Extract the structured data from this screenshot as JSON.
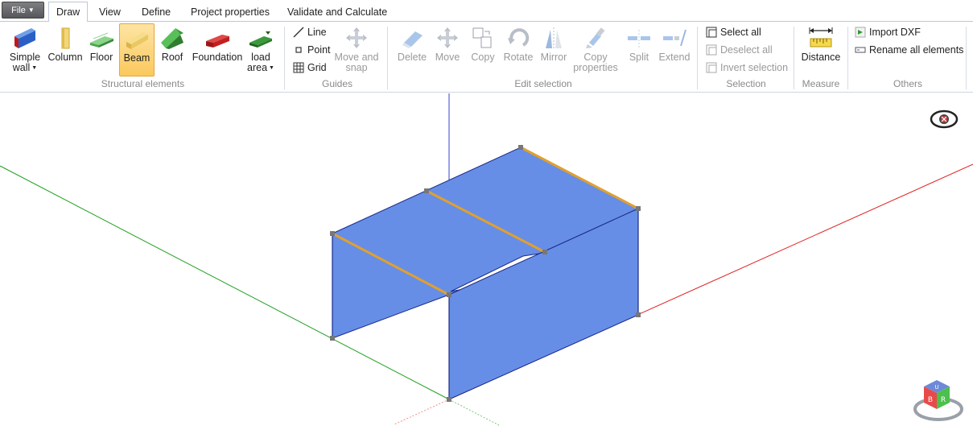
{
  "file_menu": {
    "label": "File"
  },
  "tabs": [
    {
      "label": "Draw",
      "active": true
    },
    {
      "label": "View"
    },
    {
      "label": "Define"
    },
    {
      "label": "Project properties"
    },
    {
      "label": "Validate and Calculate"
    }
  ],
  "groups": {
    "structural": {
      "label": "Structural elements",
      "buttons": [
        {
          "label1": "Simple",
          "label2": "wall"
        },
        {
          "label1": "Column"
        },
        {
          "label1": "Floor"
        },
        {
          "label1": "Beam",
          "selected": true
        },
        {
          "label1": "Roof"
        },
        {
          "label1": "Foundation"
        },
        {
          "label1": "load",
          "label2": "area"
        }
      ]
    },
    "guides": {
      "label": "Guides",
      "line": "Line",
      "point": "Point",
      "grid": "Grid",
      "move_snap_1": "Move and",
      "move_snap_2": "snap"
    },
    "edit": {
      "label": "Edit selection",
      "buttons": [
        {
          "label1": "Delete"
        },
        {
          "label1": "Move"
        },
        {
          "label1": "Copy"
        },
        {
          "label1": "Rotate"
        },
        {
          "label1": "Mirror"
        },
        {
          "label1": "Copy",
          "label2": "properties"
        },
        {
          "label1": "Split"
        },
        {
          "label1": "Extend"
        }
      ]
    },
    "selection": {
      "label": "Selection",
      "select_all": "Select all",
      "deselect_all": "Deselect all",
      "invert": "Invert selection"
    },
    "measure": {
      "label": "Measure",
      "distance": "Distance"
    },
    "others": {
      "label": "Others",
      "import_dxf": "Import DXF",
      "rename_all": "Rename all elements"
    }
  },
  "navcube": {
    "faces": [
      "U",
      "B",
      "R"
    ]
  },
  "colors": {
    "accent_selected": "#fbc95c",
    "wall_fill": "#668ee6",
    "beam": "#e0a030",
    "axis_x": "#e02020",
    "axis_y": "#20a020",
    "axis_z": "#3040d0"
  }
}
